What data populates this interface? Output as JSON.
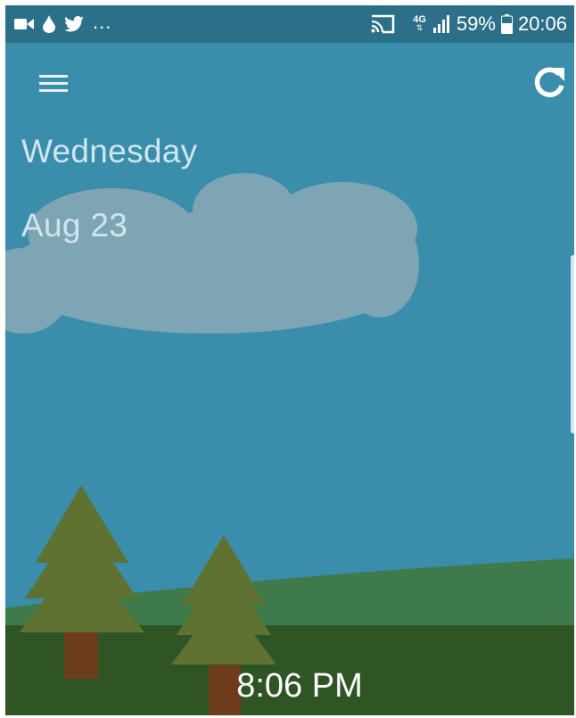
{
  "status_bar": {
    "left_icons": [
      "video-camera-icon",
      "water-drop-icon",
      "twitter-bird-icon"
    ],
    "more_notifications": "...",
    "network_label": "4G",
    "battery_percent": "59%",
    "clock": "20:06"
  },
  "toolbar": {
    "menu_icon": "hamburger-menu-icon",
    "refresh_icon": "refresh-icon"
  },
  "weather": {
    "day": "Wednesday",
    "date": "Aug 23",
    "time": "8:06 PM"
  },
  "colors": {
    "sky": "#3a8dab",
    "status_bar": "#2c6f88",
    "cloud": "#7ea5b4",
    "hill_far": "#3f7b4a",
    "ground": "#2f5524",
    "tree": "#5e7231",
    "trunk": "#6d3d1b"
  }
}
